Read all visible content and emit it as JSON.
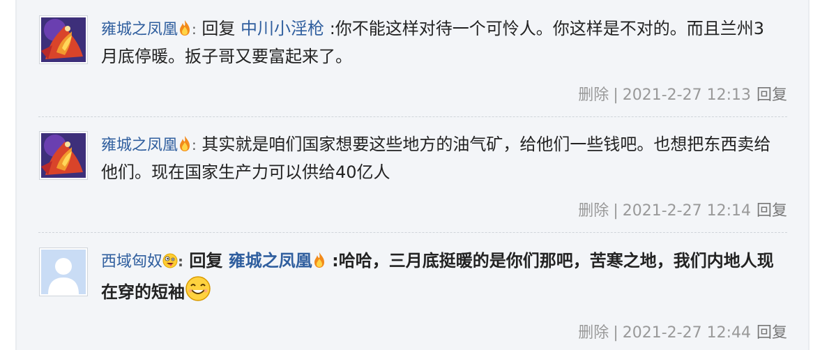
{
  "replies": [
    {
      "username": "雍城之凤凰",
      "reply_word": "回复",
      "mention": "中川小淫枪",
      "text": ":你不能这样对待一个可怜人。你这样是不对的。而且兰州3月底停暖。扳子哥又要富起来了。",
      "delete_label": "删除",
      "time": "2021-2-27 12:13",
      "reply_label": "回复",
      "badge_icon": "flame-icon"
    },
    {
      "username": "雍城之凤凰",
      "text": "其实就是咱们国家想要这些地方的油气矿，给他们一些钱吧。也想把东西卖给他们。现在国家生产力可以供给40亿人",
      "delete_label": "删除",
      "time": "2021-2-27 12:14",
      "reply_label": "回复",
      "badge_icon": "flame-icon"
    },
    {
      "username": "西域匈奴",
      "reply_word": "回复",
      "mention": "雍城之凤凰",
      "text": ":哈哈，三月底挺暖的是你们那吧，苦寒之地，我们内地人现在穿的短袖",
      "delete_label": "删除",
      "time": "2021-2-27 12:44",
      "reply_label": "回复",
      "badge_icon": "crazy-face-icon",
      "emoji": "smile-emoji-icon"
    }
  ],
  "separator": "|",
  "name_colon": ":",
  "colors": {
    "link": "#2f5e9e",
    "meta": "#999999",
    "panel_bg": "#f3f5f8"
  }
}
